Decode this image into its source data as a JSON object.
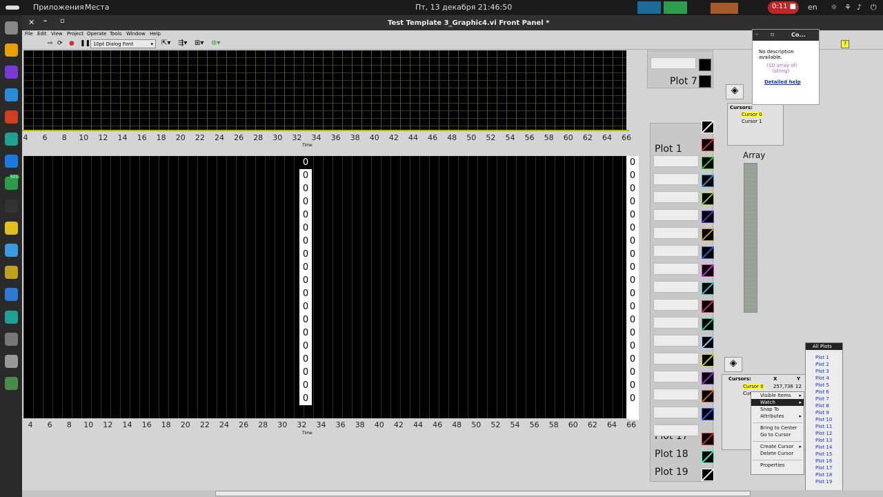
{
  "topbar": {
    "apps": "Приложения",
    "places": "Места",
    "clock": "Пт, 13 декабря  21:46:50",
    "recording": "0:11",
    "lang": "en"
  },
  "dock": {
    "icons": [
      "files-icon",
      "chrome-icon",
      "tor-icon",
      "app-icon",
      "fonts-icon",
      "vscode-icon",
      "vscode-blue-icon",
      "badge-icon",
      "terminal-icon",
      "notes-icon",
      "text-editor-icon",
      "video-icon",
      "help-icon",
      "vscode-alt-icon",
      "settings-icon",
      "blank-icon",
      "trash-icon"
    ],
    "badge": "501"
  },
  "window": {
    "title": "Test Template 3_Graphic4.vi Front Panel *"
  },
  "menu": [
    "File",
    "Edit",
    "View",
    "Project",
    "Operate",
    "Tools",
    "Window",
    "Help"
  ],
  "toolbar": {
    "font": "10pt Dialog Font"
  },
  "axis_ticks": [
    "4",
    "6",
    "8",
    "10",
    "12",
    "14",
    "16",
    "18",
    "20",
    "22",
    "24",
    "26",
    "28",
    "30",
    "32",
    "34",
    "36",
    "38",
    "40",
    "42",
    "44",
    "46",
    "48",
    "50",
    "52",
    "54",
    "56",
    "58",
    "60",
    "62",
    "64",
    "66"
  ],
  "axis_name": "Time",
  "zeros_count_label": "0",
  "legend_top": {
    "plot7": "Plot 7",
    "plot1": "Plot 1"
  },
  "legend_bottom": {
    "plot17": "Plot 17",
    "plot18": "Plot 18",
    "plot19": "Plot 19"
  },
  "array_label": "Array",
  "cursors1": {
    "title": "Cursors:",
    "items": [
      "Cursor 0",
      "Cursor 1"
    ]
  },
  "cursors2": {
    "title": "Cursors:",
    "col_x": "X",
    "col_y": "Y",
    "items": [
      "Cursor 0",
      "Cursor 1"
    ],
    "x_val": "257,736",
    "y_val": "12"
  },
  "context_help": {
    "title": "Co...",
    "desc": "No description available.",
    "type1": "(1D array of)",
    "type2": "(string)",
    "link": "Detailed help"
  },
  "context_menu": [
    "Visible Items",
    "Watch",
    "Snap To",
    "Attributes",
    "",
    "Bring to Center",
    "Go to Cursor",
    "",
    "Create Cursor",
    "Delete Cursor",
    "",
    "Properties"
  ],
  "plots_menu": {
    "header": "All Plots",
    "items": [
      "Plot 1",
      "Plot 2",
      "Plot 3",
      "Plot 4",
      "Plot 5",
      "Plot 6",
      "Plot 7",
      "Plot 8",
      "Plot 9",
      "Plot 10",
      "Plot 11",
      "Plot 12",
      "Plot 13",
      "Plot 14",
      "Plot 15",
      "Plot 16",
      "Plot 17",
      "Plot 18",
      "Plot 19"
    ]
  }
}
